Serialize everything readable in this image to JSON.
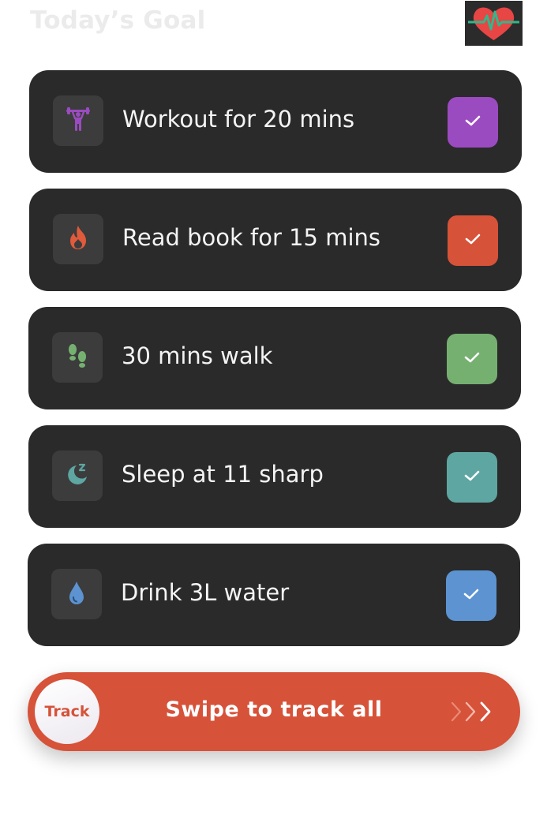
{
  "header": {
    "title": "Today’s Goal",
    "logo_icon": "heart-pulse-icon"
  },
  "tasks": [
    {
      "label": "Workout for 20 mins",
      "icon": "weightlifter-icon",
      "accent": "#9b4bc0",
      "checked": true
    },
    {
      "label": "Read book for 15 mins",
      "icon": "flame-icon",
      "accent": "#d65239",
      "checked": true
    },
    {
      "label": "30 mins walk",
      "icon": "footprints-icon",
      "accent": "#75b070",
      "checked": true
    },
    {
      "label": "Sleep at 11 sharp",
      "icon": "moon-sleep-icon",
      "accent": "#5ea6a1",
      "checked": true
    },
    {
      "label": "Drink 3L water",
      "icon": "water-drop-icon",
      "accent": "#5c93d0",
      "checked": true
    }
  ],
  "swipe": {
    "knob_label": "Track",
    "label": "Swipe to track all",
    "background": "#d65239",
    "arrow_icon": "chevrons-right-icon"
  },
  "colors": {
    "card_background": "#2a2a2a",
    "icon_box_background": "#3c3c3c",
    "title_color": "#ebebeb"
  }
}
